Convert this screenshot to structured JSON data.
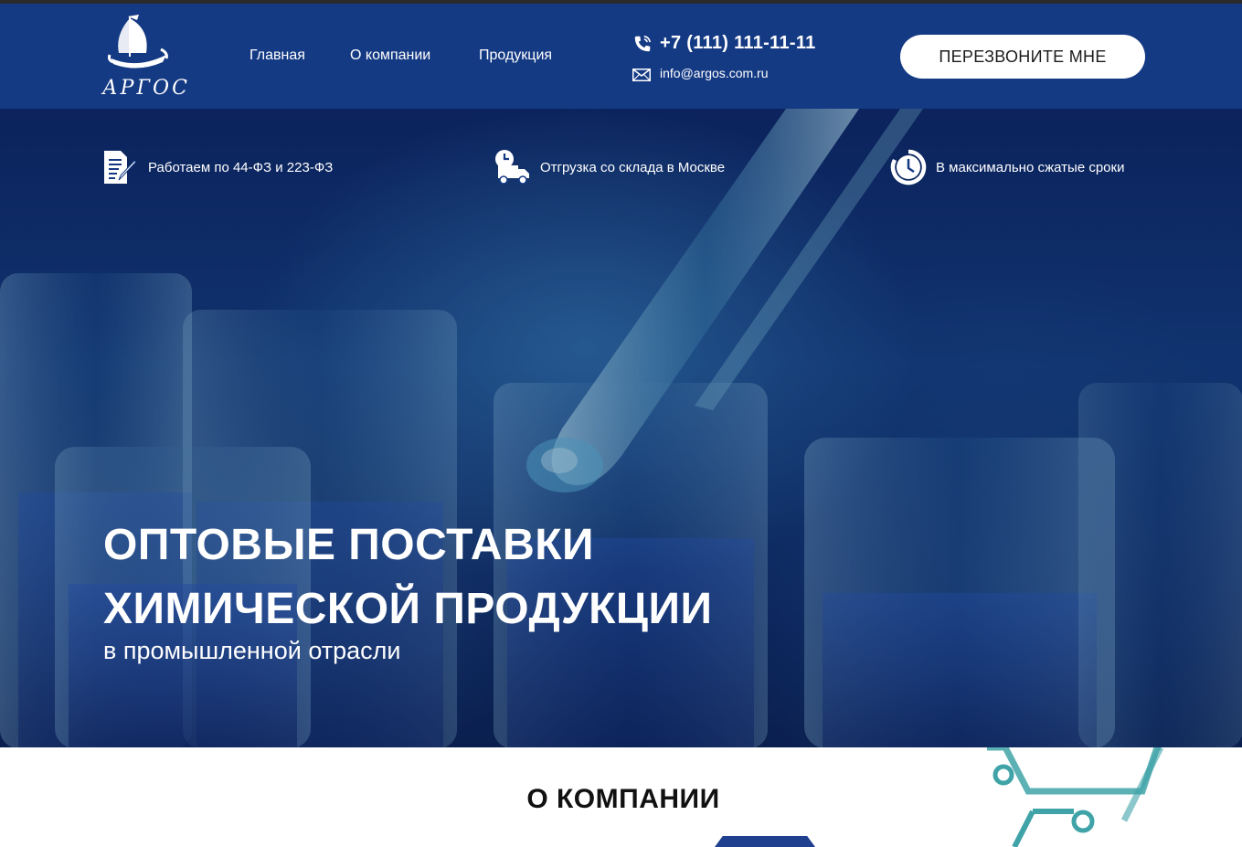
{
  "brand": {
    "name": "АРГОС"
  },
  "nav": {
    "items": [
      {
        "label": "Главная"
      },
      {
        "label": "О компании"
      },
      {
        "label": "Продукция"
      }
    ]
  },
  "contacts": {
    "phone": "+7 (111) 111-11-11",
    "email": "info@argos.com.ru"
  },
  "callback_button": {
    "label": "ПЕРЕЗВОНИТЕ МНЕ"
  },
  "features": [
    {
      "icon": "document-edit-icon",
      "text": "Работаем по 44-ФЗ и 223-ФЗ"
    },
    {
      "icon": "delivery-truck-icon",
      "text": "Отгрузка со склада в Москве"
    },
    {
      "icon": "clock-icon",
      "text": "В максимально сжатые сроки"
    }
  ],
  "hero": {
    "title_line1": "ОПТОВЫЕ ПОСТАВКИ",
    "title_line2": "ХИМИЧЕСКОЙ ПРОДУКЦИИ",
    "subtitle": "в промышленной отрасли"
  },
  "about": {
    "title": "О КОМПАНИИ"
  },
  "colors": {
    "header_bg": "#153a84",
    "accent_teal": "#3fa3a8",
    "button_bg": "#ffffff",
    "tab_blue": "#1f3f8f"
  }
}
